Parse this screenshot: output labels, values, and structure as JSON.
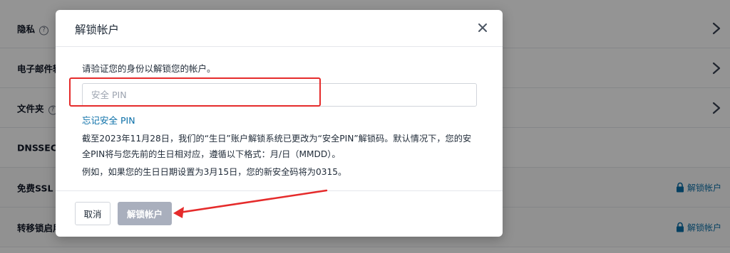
{
  "background": {
    "rows": [
      {
        "label": "隐私",
        "has_help": true,
        "action": "chevron"
      },
      {
        "label": "电子邮件转",
        "has_help": false,
        "action": "chevron"
      },
      {
        "label": "文件夹",
        "has_help": true,
        "action": "chevron"
      },
      {
        "label": "DNSSEC",
        "has_help": false,
        "action": "none"
      },
      {
        "label": "免费SSL",
        "has_help": false,
        "action": "unlock"
      },
      {
        "label": "转移锁启用",
        "has_help": false,
        "action": "unlock"
      }
    ],
    "help_glyph": "?",
    "unlock_label": "解锁帐户"
  },
  "modal": {
    "title": "解锁帐户",
    "instruction": "请验证您的身份以解锁您的帐户。",
    "pin_placeholder": "安全 PIN",
    "pin_value": "",
    "forgot_link": "忘记安全 PIN",
    "notice": "截至2023年11月28日，我们的“生日”账户解锁系统已更改为“安全PIN”解锁码。默认情况下，您的安全PIN将与您先前的生日相对应，遵循以下格式：月/日（MMDD）。",
    "example": "例如，如果您的生日日期设置为3月15日，您的新安全码将为0315。",
    "cancel_label": "取消",
    "unlock_label": "解锁帐户"
  },
  "annotations": {
    "highlight_color": "#e52b2b",
    "arrow_color": "#e52b2b"
  },
  "colors": {
    "link": "#0a6fa8",
    "disabled_button": "#a9afbd",
    "overlay": "rgba(0,0,0,0.42)"
  },
  "icons": {
    "close": "close-icon",
    "chevron": "chevron-right-icon",
    "lock": "lock-icon",
    "help": "help-circle-icon"
  }
}
